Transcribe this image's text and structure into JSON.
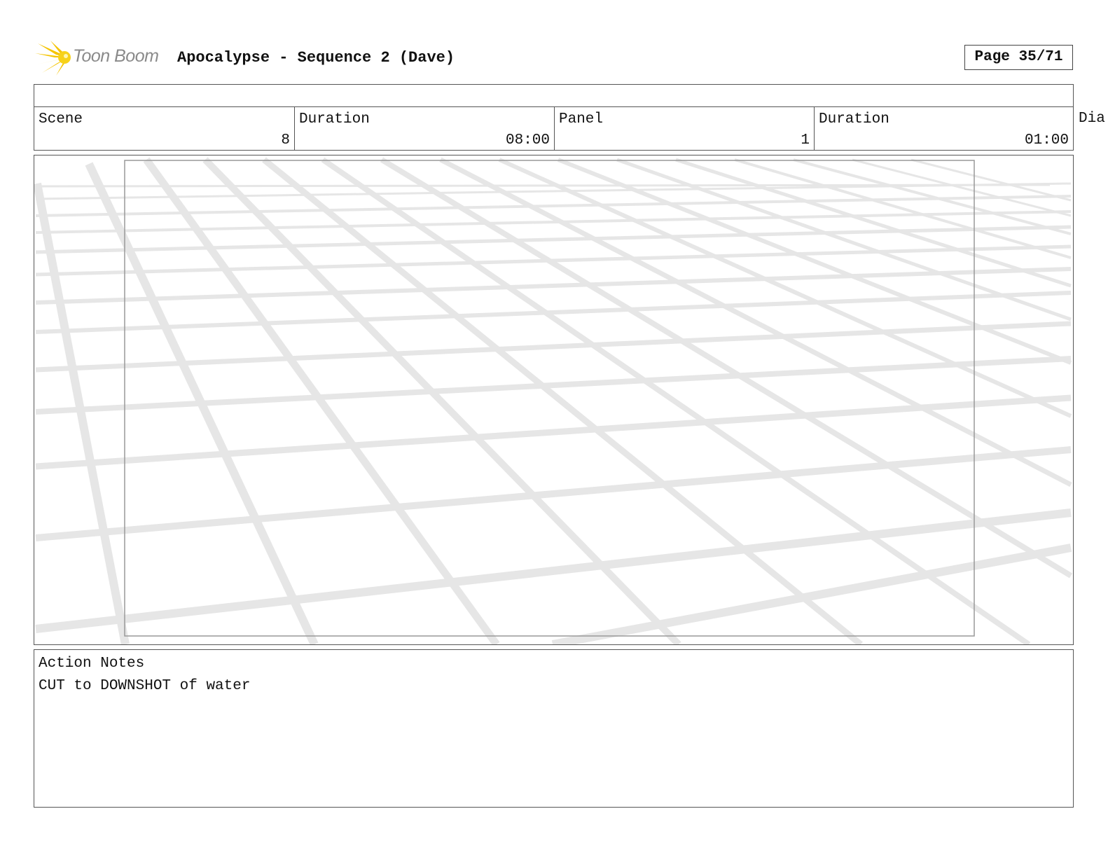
{
  "header": {
    "logo_text": "Toon Boom",
    "title": "Apocalypse - Sequence 2 (Dave)",
    "page_label": "Page 35/71",
    "logo_icon": "starburst-logo-icon",
    "logo_color": "#f5c400"
  },
  "info": {
    "scene_label": "Scene",
    "scene_value": "8",
    "scene_duration_label": "Duration",
    "scene_duration_value": "08:00",
    "panel_label": "Panel",
    "panel_value": "1",
    "panel_duration_label": "Duration",
    "panel_duration_value": "01:00",
    "dialogue_label": "Dia"
  },
  "panel": {
    "image_description_icon": "perspective-grid-floor",
    "grid_color": "#e6e6e6"
  },
  "notes": {
    "label": "Action Notes",
    "text": "CUT to DOWNSHOT of water"
  }
}
